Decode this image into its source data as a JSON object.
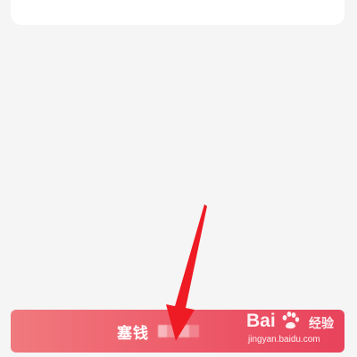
{
  "send_button": {
    "label": "塞钱"
  },
  "watermark": {
    "brand_a": "Bai",
    "brand_b": "经验",
    "url": "jingyan.baidu.com"
  },
  "colors": {
    "background": "#f5f5f5",
    "button_start": "#f07a7e",
    "button_end": "#e8435c",
    "arrow": "#ee1b24"
  }
}
